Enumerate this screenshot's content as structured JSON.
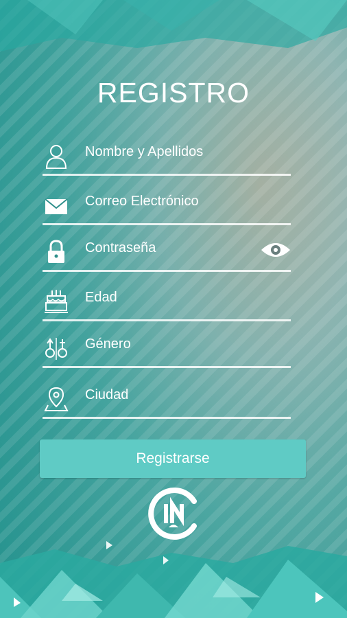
{
  "title": "REGISTRO",
  "fields": [
    {
      "label": "Nombre y Apellidos",
      "icon": "user-icon"
    },
    {
      "label": "Correo Electrónico",
      "icon": "envelope-icon"
    },
    {
      "label": "Contraseña",
      "icon": "lock-icon"
    },
    {
      "label": "Edad",
      "icon": "cake-icon"
    },
    {
      "label": "Género",
      "icon": "gender-icon"
    },
    {
      "label": "Ciudad",
      "icon": "location-pin-icon"
    }
  ],
  "register_button": "Registrarse",
  "colors": {
    "accent": "#5fcbc5",
    "background": "#2f8f8b"
  }
}
